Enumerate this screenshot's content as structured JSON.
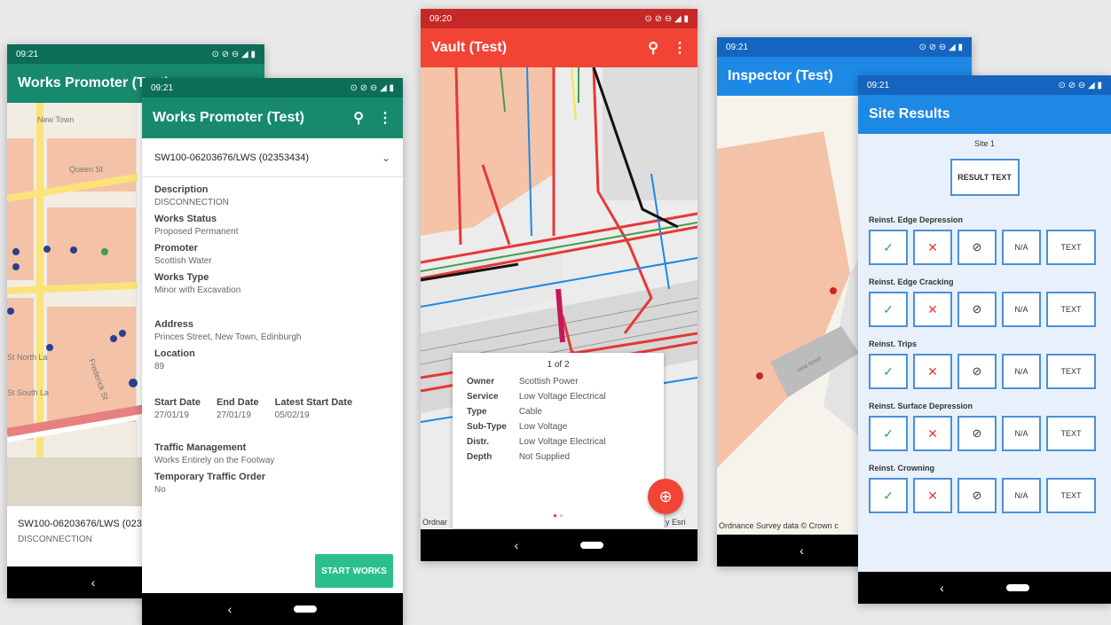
{
  "colors": {
    "teal": "#178a6e",
    "red": "#f24434",
    "blue": "#1e88e5",
    "map_bg": "#f1ede3",
    "building": "#f4c2a6"
  },
  "phone1_back": {
    "status_time": "09:21",
    "title": "Works Promoter (Test)",
    "map_labels": [
      "New Town",
      "Queen St",
      "St North La",
      "St South La",
      "Frederick St"
    ],
    "footer_ref": "SW100-06203676/LWS (0235",
    "footer_desc": "DISCONNECTION"
  },
  "phone1_front": {
    "status_time": "09:21",
    "title": "Works Promoter (Test)",
    "permit": "SW100-06203676/LWS (02353434)",
    "fields": [
      {
        "label": "Description",
        "value": "DISCONNECTION"
      },
      {
        "label": "Works Status",
        "value": "Proposed Permanent"
      },
      {
        "label": "Promoter",
        "value": "Scottish Water"
      },
      {
        "label": "Works Type",
        "value": "Minor with Excavation"
      }
    ],
    "address_label": "Address",
    "address": "Princes Street, New Town, Edinburgh",
    "location_label": "Location",
    "location": "89",
    "dates": [
      {
        "label": "Start Date",
        "value": "27/01/19"
      },
      {
        "label": "End Date",
        "value": "27/01/19"
      },
      {
        "label": "Latest Start Date",
        "value": "05/02/19"
      }
    ],
    "traffic_label": "Traffic Management",
    "traffic": "Works Entirely on the Footway",
    "tto_label": "Temporary Traffic Order",
    "tto": "No",
    "start_button": "START WORKS"
  },
  "phone2": {
    "status_time": "09:20",
    "title": "Vault (Test)",
    "pager": "1 of 2",
    "rows": [
      {
        "k": "Owner",
        "v": "Scottish Power"
      },
      {
        "k": "Service",
        "v": "Low Voltage Electrical"
      },
      {
        "k": "Type",
        "v": "Cable"
      },
      {
        "k": "Sub-Type",
        "v": "Low Voltage"
      },
      {
        "k": "Distr.",
        "v": "Low Voltage Electrical"
      },
      {
        "k": "Depth",
        "v": "Not Supplied"
      }
    ],
    "attr_left": "Ordnar",
    "attr_right": "y Esri"
  },
  "phone3_back": {
    "status_time": "09:21",
    "title": "Inspector (Test)",
    "attribution": "Ordnance Survey data © Crown c",
    "road_label": "Hind Street"
  },
  "phone3_front": {
    "status_time": "09:21",
    "title": "Site Results",
    "site": "Site 1",
    "result_button": "RESULT TEXT",
    "sections": [
      {
        "title": "Reinst. Edge Depression"
      },
      {
        "title": "Reinst. Edge Cracking"
      },
      {
        "title": "Reinst. Trips"
      },
      {
        "title": "Reinst. Surface Depression"
      },
      {
        "title": "Reinst. Crowning"
      }
    ],
    "btn_na": "N/A",
    "btn_text": "TEXT"
  }
}
